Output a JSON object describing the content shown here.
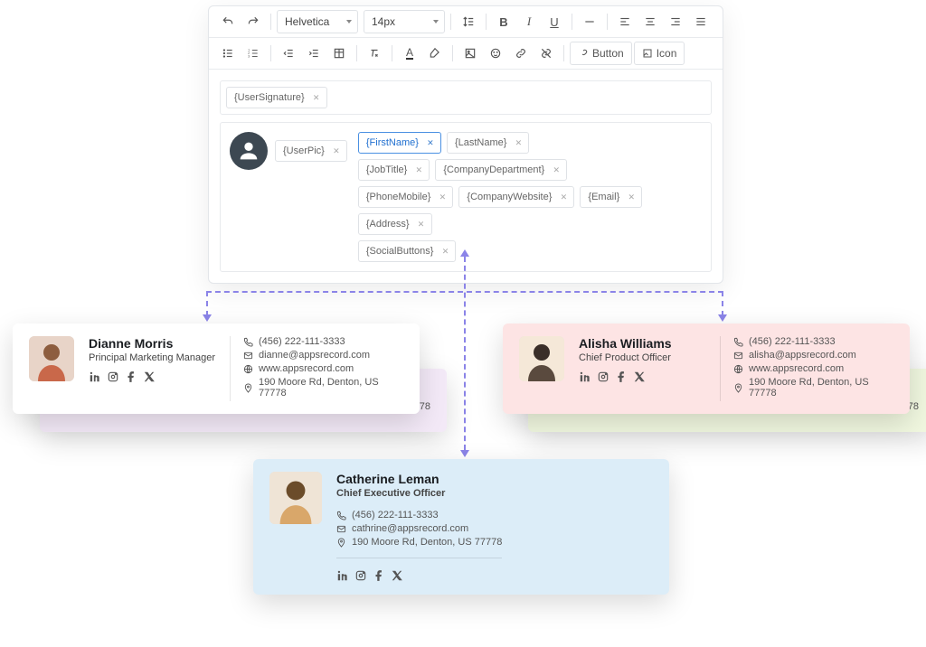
{
  "toolbar": {
    "font": "Helvetica",
    "size": "14px",
    "button_label": "Button",
    "icon_label": "Icon"
  },
  "template_tags": {
    "user_signature": "{UserSignature}",
    "user_pic": "{UserPic}",
    "first_name": "{FirstName}",
    "last_name": "{LastName}",
    "job_title": "{JobTitle}",
    "company_department": "{CompanyDepartment}",
    "phone_mobile": "{PhoneMobile}",
    "company_website": "{CompanyWebsite}",
    "email": "{Email}",
    "address": "{Address}",
    "social_buttons": "{SocialButtons}"
  },
  "cards": {
    "c1": {
      "name": "Dianne Morris",
      "title": "Principal Marketing Manager",
      "phone": "(456) 222-111-3333",
      "email": "dianne@appsrecord.com",
      "web": "www.appsrecord.com",
      "addr": "190 Moore Rd, Denton, US 77778"
    },
    "c2": {
      "name": "Alisha Williams",
      "title": "Chief Product Officer",
      "phone": "(456) 222-111-3333",
      "email": "alisha@appsrecord.com",
      "web": "www.appsrecord.com",
      "addr": "190 Moore Rd, Denton, US 77778"
    },
    "c3": {
      "name": "Catherine Leman",
      "title": "Chief Executive Officer",
      "phone": "(456) 222-111-3333",
      "email": "cathrine@appsrecord.com",
      "addr": "190 Moore Rd, Denton, US 77778"
    },
    "b_addr": "190 Moore Rd, Denton, US 77778"
  }
}
